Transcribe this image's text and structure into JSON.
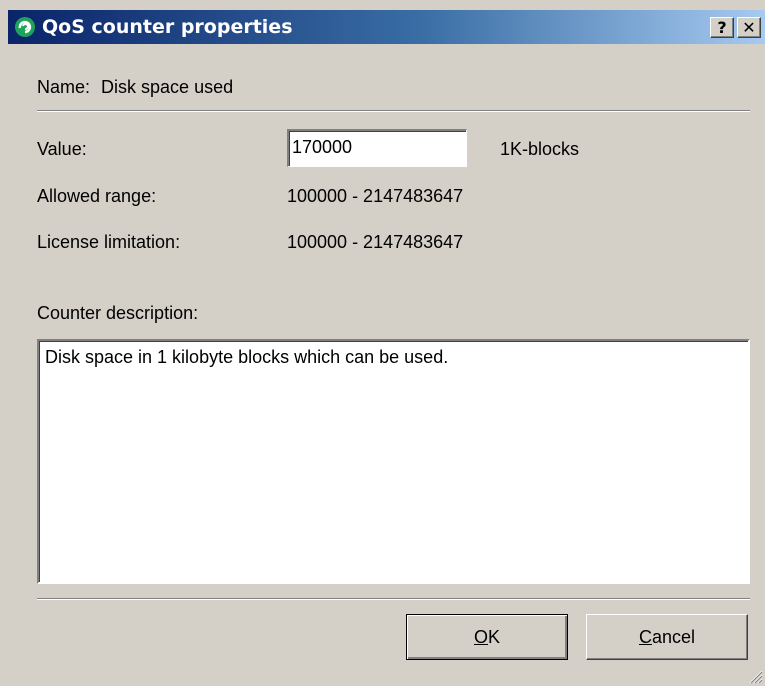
{
  "window": {
    "title": "QoS counter properties",
    "help_label": "?",
    "close_label": "✕"
  },
  "form": {
    "name_label": "Name:",
    "name_value": "Disk space used",
    "value_label": "Value:",
    "value_input": "170000",
    "value_unit": "1K-blocks",
    "allowed_range_label": "Allowed range:",
    "allowed_range_value": "100000 - 2147483647",
    "license_label": "License limitation:",
    "license_value": "100000 - 2147483647",
    "description_label": "Counter description:",
    "description_text": "Disk space in 1 kilobyte blocks which can be used."
  },
  "buttons": {
    "ok_mnemonic": "O",
    "ok_rest": "K",
    "cancel_mnemonic": "C",
    "cancel_rest": "ancel"
  },
  "colors": {
    "titlebar_start": "#0a246a",
    "titlebar_end": "#a6caf0",
    "face": "#d4d0c8"
  }
}
